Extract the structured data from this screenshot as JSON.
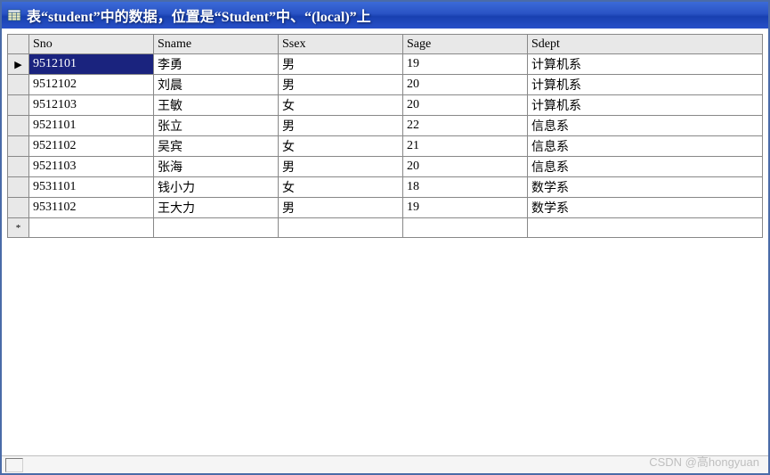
{
  "window": {
    "title": "表“student”中的数据，位置是“Student”中、“(local)”上"
  },
  "grid": {
    "columns": [
      "Sno",
      "Sname",
      "Ssex",
      "Sage",
      "Sdept"
    ],
    "rows": [
      {
        "indicator": "▶",
        "cells": [
          "9512101",
          "李勇",
          "男",
          "19",
          "计算机系"
        ],
        "current": true
      },
      {
        "indicator": "",
        "cells": [
          "9512102",
          "刘晨",
          "男",
          "20",
          "计算机系"
        ],
        "current": false
      },
      {
        "indicator": "",
        "cells": [
          "9512103",
          "王敏",
          "女",
          "20",
          "计算机系"
        ],
        "current": false
      },
      {
        "indicator": "",
        "cells": [
          "9521101",
          "张立",
          "男",
          "22",
          "信息系"
        ],
        "current": false
      },
      {
        "indicator": "",
        "cells": [
          "9521102",
          "吴宾",
          "女",
          "21",
          "信息系"
        ],
        "current": false
      },
      {
        "indicator": "",
        "cells": [
          "9521103",
          "张海",
          "男",
          "20",
          "信息系"
        ],
        "current": false
      },
      {
        "indicator": "",
        "cells": [
          "9531101",
          "钱小力",
          "女",
          "18",
          "数学系"
        ],
        "current": false
      },
      {
        "indicator": "",
        "cells": [
          "9531102",
          "王大力",
          "男",
          "19",
          "数学系"
        ],
        "current": false
      }
    ],
    "new_row_indicator": "*"
  },
  "watermark": "CSDN @高hongyuan"
}
